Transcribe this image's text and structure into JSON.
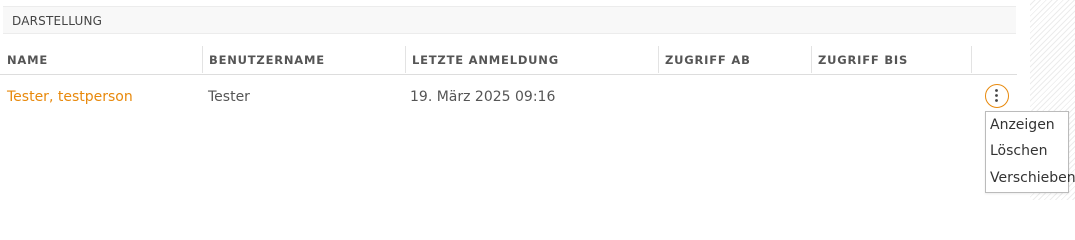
{
  "section": {
    "title": "DARSTELLUNG"
  },
  "table": {
    "columns": [
      "NAME",
      "BENUTZERNAME",
      "LETZTE ANMELDUNG",
      "ZUGRIFF AB",
      "ZUGRIFF BIS"
    ],
    "rows": [
      {
        "name": "Tester, testperson",
        "username": "Tester",
        "last_login": "19. März 2025 09:16",
        "access_from": "",
        "access_until": ""
      }
    ]
  },
  "row_menu": {
    "icon": "more-vertical-icon",
    "items": [
      "Anzeigen",
      "Löschen",
      "Verschieben"
    ]
  },
  "colors": {
    "accent": "#e8890c",
    "text": "#555555",
    "header_bg": "#f8f8f8",
    "border": "#dddddd"
  }
}
